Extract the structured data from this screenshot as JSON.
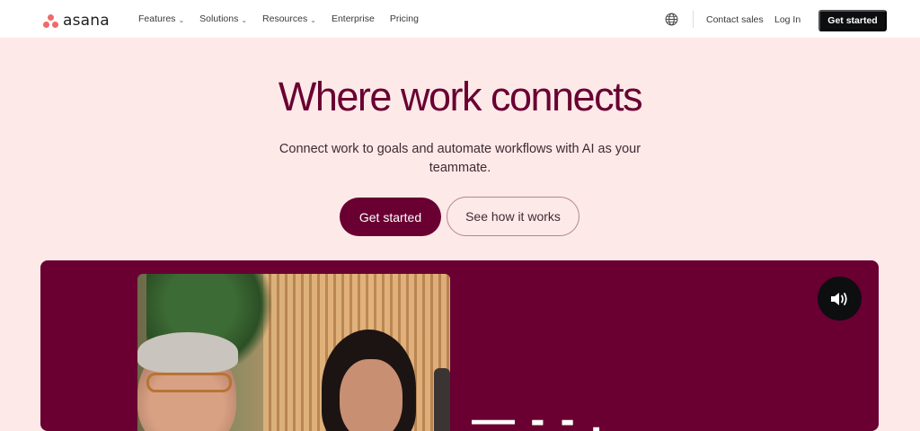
{
  "brand": {
    "logo_text": "asana",
    "logo_color": "#f06a6a"
  },
  "nav": {
    "links": [
      {
        "label": "Features",
        "has_dropdown": true
      },
      {
        "label": "Solutions",
        "has_dropdown": true
      },
      {
        "label": "Resources",
        "has_dropdown": true
      },
      {
        "label": "Enterprise",
        "has_dropdown": false
      },
      {
        "label": "Pricing",
        "has_dropdown": false
      }
    ],
    "globe_icon": "globe-icon",
    "contact_sales": "Contact sales",
    "login": "Log In",
    "cta": "Get started"
  },
  "hero": {
    "title": "Where work connects",
    "subtitle": "Connect work to goals and automate workflows with AI as your teammate.",
    "primary_button": "Get started",
    "secondary_button": "See how it works"
  },
  "video": {
    "sound_icon": "speaker-icon",
    "caption_fragment": "— - -   ."
  },
  "colors": {
    "accent": "#690031",
    "page_background": "#fde9e8",
    "nav_cta_background": "#0d0e10"
  }
}
